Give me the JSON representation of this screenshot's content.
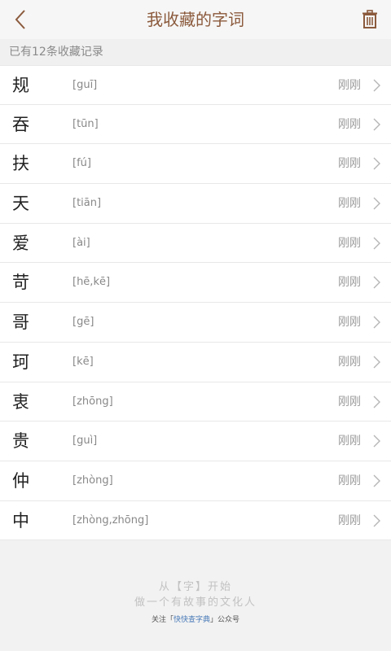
{
  "header": {
    "title": "我收藏的字词",
    "back_icon": "chevron-left-icon",
    "trash_icon": "trash-icon",
    "accent_color": "#8b5a3c"
  },
  "count": {
    "text": "已有12条收藏记录"
  },
  "items": [
    {
      "char": "规",
      "pinyin": "[guī]",
      "time": "刚刚"
    },
    {
      "char": "吞",
      "pinyin": "[tūn]",
      "time": "刚刚"
    },
    {
      "char": "扶",
      "pinyin": "[fú]",
      "time": "刚刚"
    },
    {
      "char": "天",
      "pinyin": "[tiān]",
      "time": "刚刚"
    },
    {
      "char": "爱",
      "pinyin": "[ài]",
      "time": "刚刚"
    },
    {
      "char": "苛",
      "pinyin": "[hē,kē]",
      "time": "刚刚"
    },
    {
      "char": "哥",
      "pinyin": "[gē]",
      "time": "刚刚"
    },
    {
      "char": "珂",
      "pinyin": "[kē]",
      "time": "刚刚"
    },
    {
      "char": "衷",
      "pinyin": "[zhōng]",
      "time": "刚刚"
    },
    {
      "char": "贵",
      "pinyin": "[guì]",
      "time": "刚刚"
    },
    {
      "char": "仲",
      "pinyin": "[zhòng]",
      "time": "刚刚"
    },
    {
      "char": "中",
      "pinyin": "[zhòng,zhōng]",
      "time": "刚刚"
    }
  ],
  "footer": {
    "line1": "从【字】开始",
    "line2": "做一个有故事的文化人",
    "line3_prefix": "关注「",
    "line3_brand": "快快查字典",
    "line3_suffix": "」公众号"
  }
}
